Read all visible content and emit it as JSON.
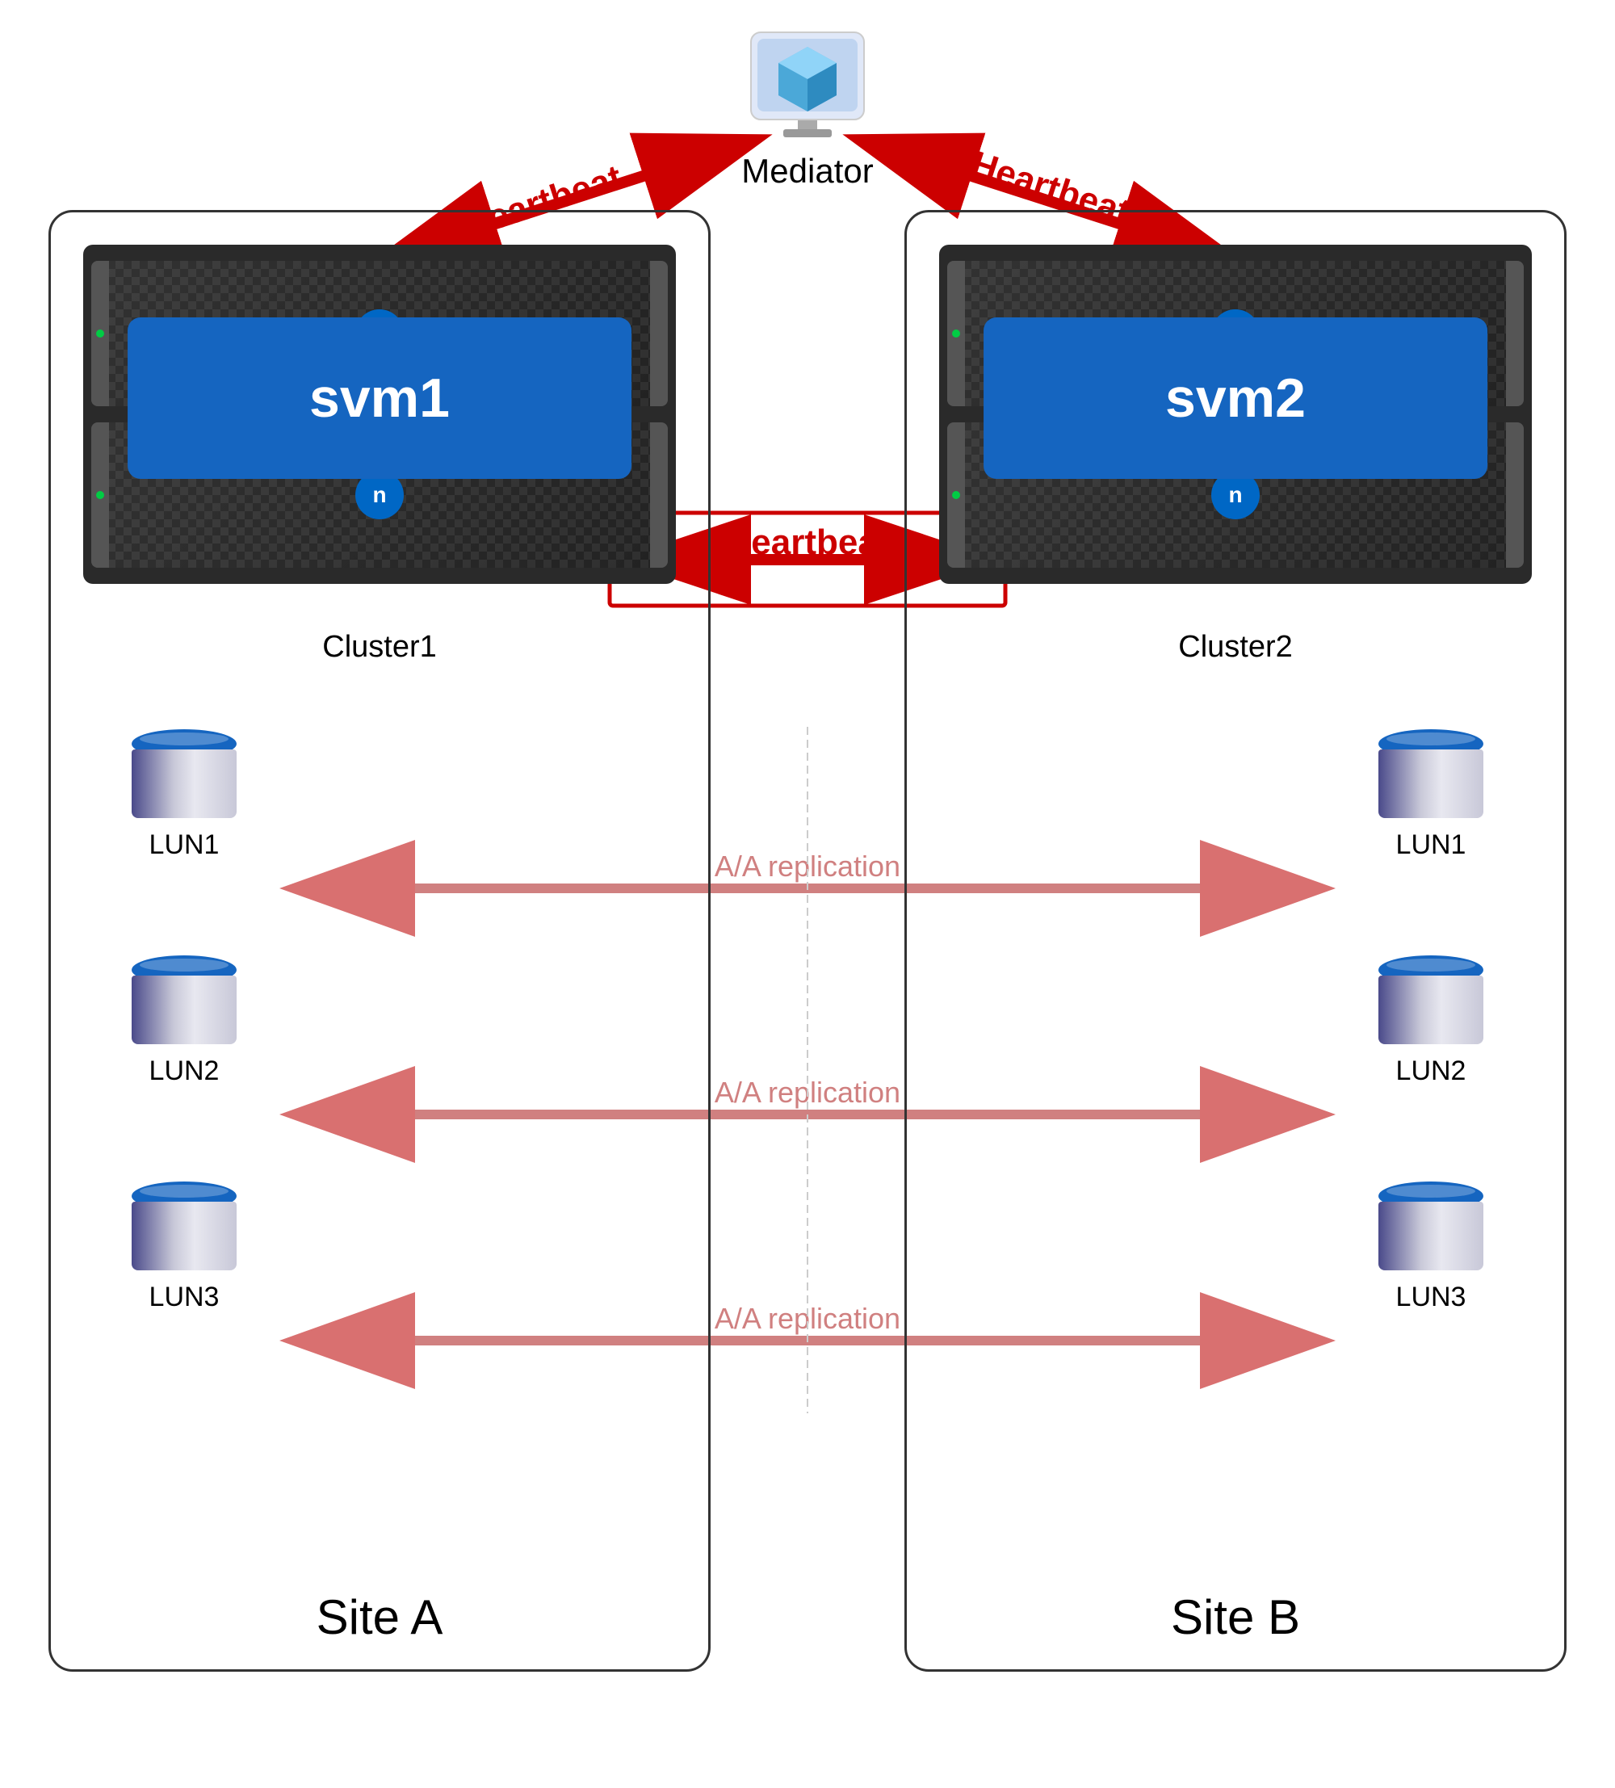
{
  "mediator": {
    "label": "Mediator"
  },
  "siteA": {
    "label": "Site A",
    "cluster": {
      "name": "Cluster1",
      "svm": "svm1"
    },
    "luns": [
      "LUN1",
      "LUN2",
      "LUN3"
    ]
  },
  "siteB": {
    "label": "Site B",
    "cluster": {
      "name": "Cluster2",
      "svm": "svm2"
    },
    "luns": [
      "LUN1",
      "LUN2",
      "LUN3"
    ]
  },
  "heartbeat": {
    "label": "Heartbeat"
  },
  "replication": {
    "label": "A/A replication"
  },
  "colors": {
    "red_arrow": "#CC0000",
    "pink_arrow": "#E8A0A0",
    "svm_blue": "#1565C0",
    "mediator_blue": "#4FC3F7"
  }
}
